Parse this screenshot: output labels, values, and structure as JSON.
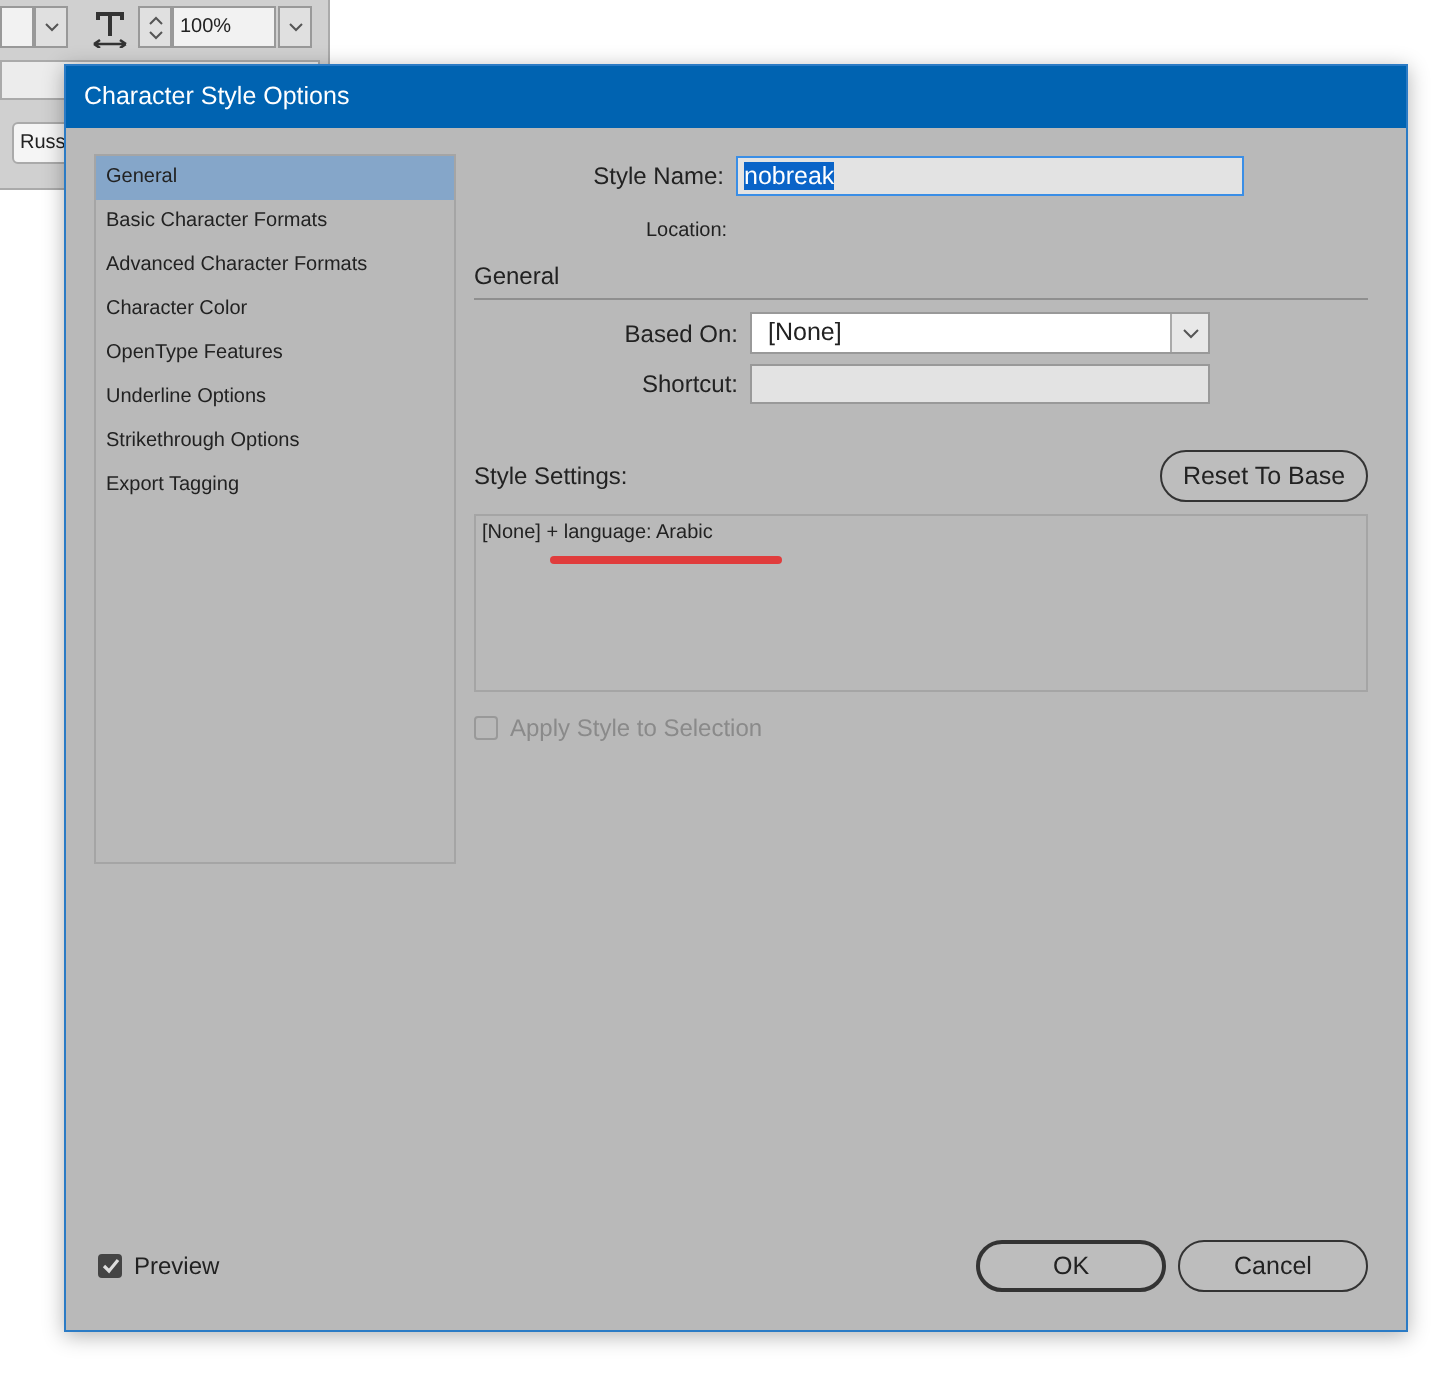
{
  "background_panel": {
    "zoom_value": "100%",
    "language_button": "Russ"
  },
  "window": {
    "title": "Character Style Options"
  },
  "sidebar": {
    "items": [
      {
        "label": "General",
        "selected": true
      },
      {
        "label": "Basic Character Formats",
        "selected": false
      },
      {
        "label": "Advanced Character Formats",
        "selected": false
      },
      {
        "label": "Character Color",
        "selected": false
      },
      {
        "label": "OpenType Features",
        "selected": false
      },
      {
        "label": "Underline Options",
        "selected": false
      },
      {
        "label": "Strikethrough Options",
        "selected": false
      },
      {
        "label": "Export Tagging",
        "selected": false
      }
    ]
  },
  "style_name": {
    "label": "Style Name:",
    "value": "nobreak",
    "value_selected": true
  },
  "location": {
    "label": "Location:"
  },
  "section_title": "General",
  "based_on": {
    "label": "Based On:",
    "value": "[None]"
  },
  "shortcut": {
    "label": "Shortcut:"
  },
  "style_settings": {
    "label": "Style Settings:",
    "reset_button": "Reset To Base",
    "text": "[None] + language: Arabic",
    "annotated": true
  },
  "apply_style": {
    "label": "Apply Style to Selection",
    "checked": false,
    "disabled": true
  },
  "preview": {
    "label": "Preview",
    "checked": true
  },
  "buttons": [
    {
      "label": "OK",
      "default": true
    },
    {
      "label": "Cancel",
      "default": false
    }
  ]
}
